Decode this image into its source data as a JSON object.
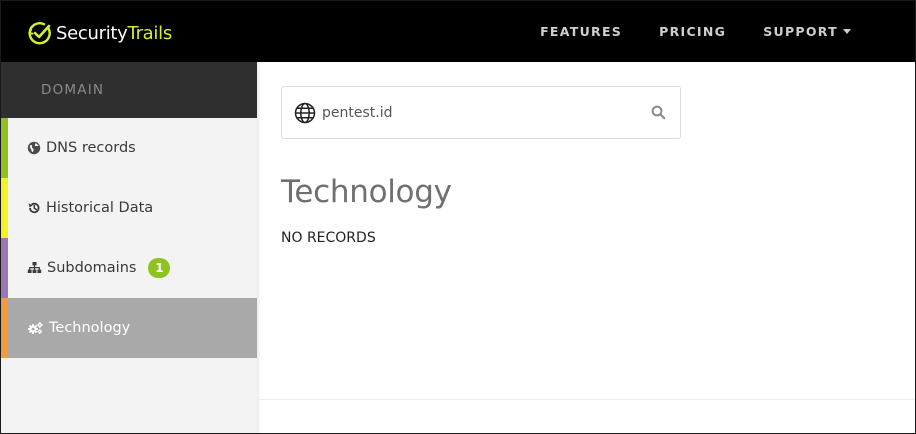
{
  "brand": {
    "name_part1": "Security",
    "name_part2": "Trails",
    "accent_color": "#d4ef2f",
    "logo_icon": "checkmark-circle-icon"
  },
  "nav": {
    "items": [
      {
        "label": "FEATURES"
      },
      {
        "label": "PRICING"
      },
      {
        "label": "SUPPORT",
        "has_dropdown": true
      }
    ]
  },
  "sidebar": {
    "header": "DOMAIN",
    "items": [
      {
        "label": "DNS records",
        "icon": "globe-icon",
        "accent": "#8ec21f",
        "active": false
      },
      {
        "label": "Historical Data",
        "icon": "history-icon",
        "accent": "#f2f22a",
        "active": false
      },
      {
        "label": "Subdomains",
        "icon": "sitemap-icon",
        "accent": "#9b78b3",
        "active": false,
        "badge": "1"
      },
      {
        "label": "Technology",
        "icon": "gears-icon",
        "accent": "#f39a3a",
        "active": true
      }
    ]
  },
  "search": {
    "value": "pentest.id",
    "icon": "globe-icon"
  },
  "main": {
    "title": "Technology",
    "empty_message": "NO RECORDS"
  }
}
